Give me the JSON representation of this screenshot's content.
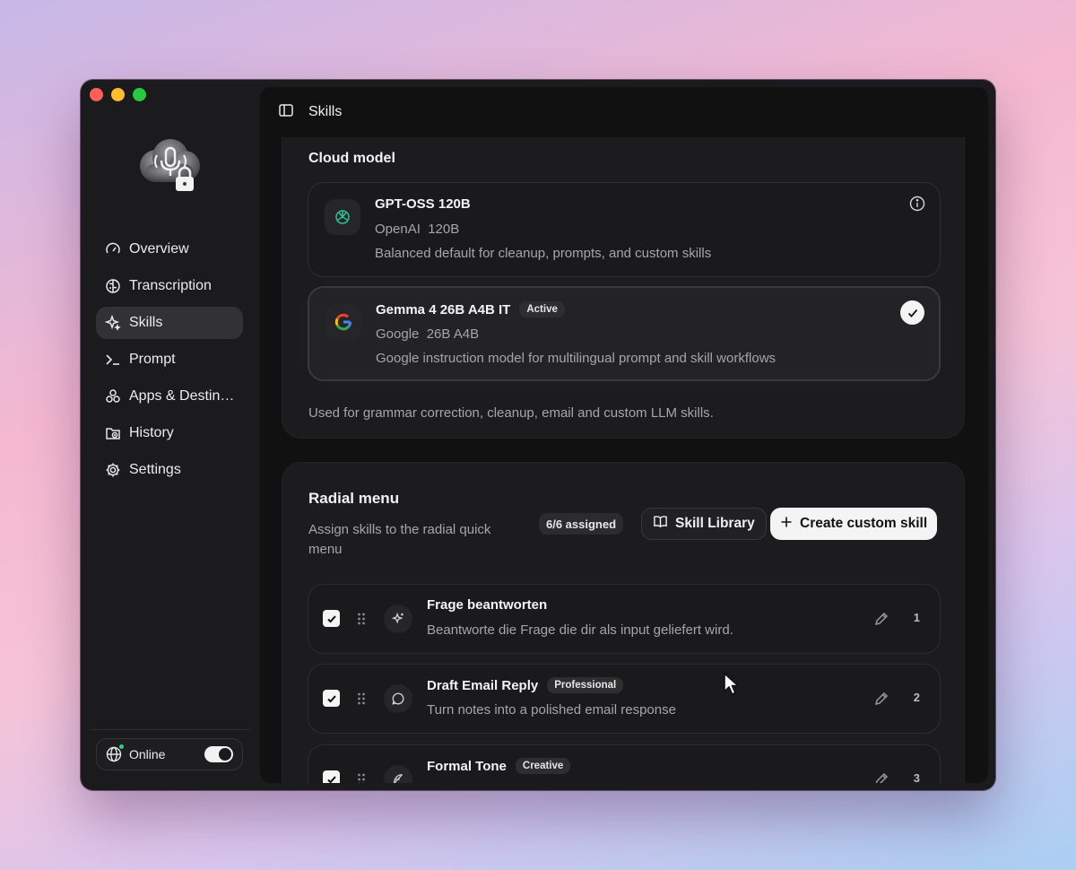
{
  "colors": {
    "accent": "#f4f4f4",
    "online_dot": "#2bd17e",
    "window_bg": "#1b1b1d",
    "card_bg": "#1c1c1e"
  },
  "sidebar": {
    "logo": "mic-cloud-lock-logo",
    "items": [
      {
        "label": "Overview",
        "icon": "gauge-icon"
      },
      {
        "label": "Transcription",
        "icon": "brain-icon"
      },
      {
        "label": "Skills",
        "icon": "sparkle-icon",
        "active": true
      },
      {
        "label": "Prompt",
        "icon": "terminal-icon"
      },
      {
        "label": "Apps & Destin…",
        "icon": "apps-icon"
      },
      {
        "label": "History",
        "icon": "folder-clock-icon"
      },
      {
        "label": "Settings",
        "icon": "gear-icon"
      }
    ],
    "status": {
      "label": "Online",
      "toggle": true
    }
  },
  "header": {
    "title": "Skills"
  },
  "cloud_model": {
    "title": "Cloud model",
    "models": [
      {
        "name": "GPT-OSS 120B",
        "sub": "OpenAI  120B",
        "desc": "Balanced default for cleanup, prompts, and custom skills",
        "icon": "openai-icon"
      },
      {
        "name": "Gemma 4 26B A4B IT",
        "badge": "Active",
        "sub": "Google  26B A4B",
        "desc": "Google instruction model for multilingual prompt and skill workflows",
        "icon": "google-icon",
        "selected": true
      }
    ],
    "note": "Used for grammar correction, cleanup, email and custom LLM skills."
  },
  "radial": {
    "title": "Radial menu",
    "desc": "Assign skills to the radial quick menu",
    "assigned": "6/6 assigned",
    "library_label": "Skill Library",
    "create_label": "Create custom skill",
    "skills": [
      {
        "name": "Frage beantworten",
        "desc": "Beantworte die Frage die dir als input geliefert wird.",
        "num": "1",
        "checked": true
      },
      {
        "name": "Draft Email Reply",
        "badge": "Professional",
        "desc": "Turn notes into a polished email response",
        "num": "2",
        "checked": true
      },
      {
        "name": "Formal Tone",
        "badge": "Creative",
        "desc": "",
        "num": "3",
        "checked": true
      }
    ]
  }
}
